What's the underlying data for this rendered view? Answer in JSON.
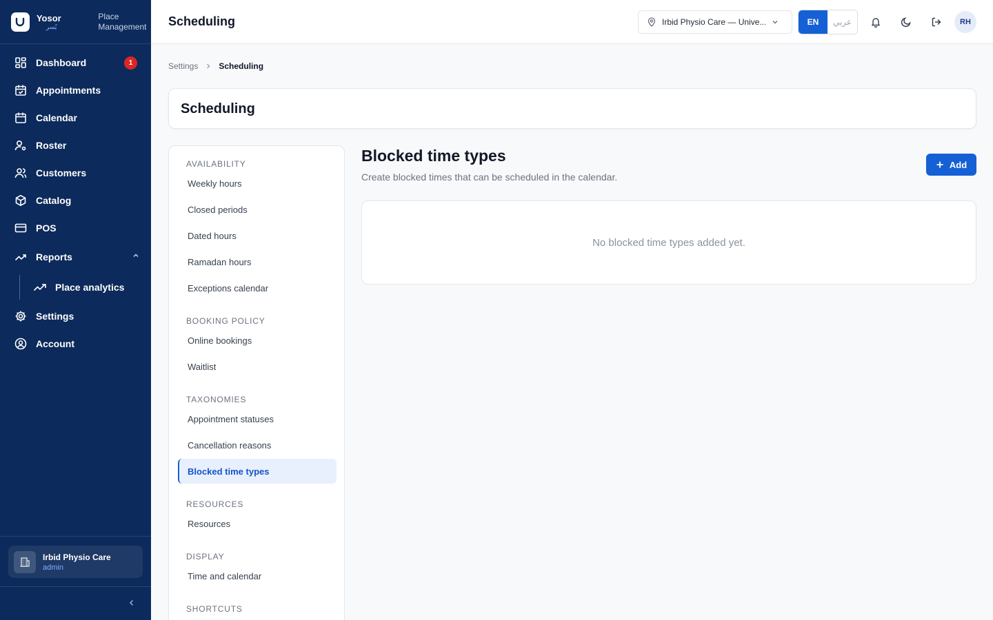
{
  "brand": {
    "name": "Yosor",
    "name_ar": "يُسر",
    "subtitle": "Place Management"
  },
  "sidebar": {
    "items": [
      {
        "label": "Dashboard",
        "icon": "dashboard-icon",
        "badge": "1"
      },
      {
        "label": "Appointments",
        "icon": "calendar-check-icon"
      },
      {
        "label": "Calendar",
        "icon": "calendar-icon"
      },
      {
        "label": "Roster",
        "icon": "user-gear-icon"
      },
      {
        "label": "Customers",
        "icon": "users-icon"
      },
      {
        "label": "Catalog",
        "icon": "package-icon"
      },
      {
        "label": "POS",
        "icon": "credit-card-icon"
      },
      {
        "label": "Reports",
        "icon": "trending-up-icon",
        "expanded": true
      },
      {
        "label": "Place analytics",
        "icon": "trending-up-icon",
        "sub": true
      },
      {
        "label": "Settings",
        "icon": "gear-icon"
      },
      {
        "label": "Account",
        "icon": "user-circle-icon"
      }
    ],
    "org": {
      "name": "Irbid Physio Care",
      "role": "admin"
    }
  },
  "topbar": {
    "title": "Scheduling",
    "location": "Irbid Physio Care — Unive...",
    "lang_en": "EN",
    "lang_ar": "عربي",
    "avatar": "RH"
  },
  "breadcrumb": {
    "parent": "Settings",
    "current": "Scheduling"
  },
  "page": {
    "title": "Scheduling"
  },
  "subnav": {
    "sections": [
      {
        "heading": "AVAILABILITY",
        "items": [
          "Weekly hours",
          "Closed periods",
          "Dated hours",
          "Ramadan hours",
          "Exceptions calendar"
        ]
      },
      {
        "heading": "BOOKING POLICY",
        "items": [
          "Online bookings",
          "Waitlist"
        ]
      },
      {
        "heading": "TAXONOMIES",
        "items": [
          "Appointment statuses",
          "Cancellation reasons",
          "Blocked time types"
        ]
      },
      {
        "heading": "RESOURCES",
        "items": [
          "Resources"
        ]
      },
      {
        "heading": "DISPLAY",
        "items": [
          "Time and calendar"
        ]
      },
      {
        "heading": "SHORTCUTS",
        "items": []
      }
    ],
    "active": "Blocked time types"
  },
  "content": {
    "title": "Blocked time types",
    "description": "Create blocked times that can be scheduled in the calendar.",
    "add_label": "Add",
    "empty_text": "No blocked time types added yet."
  },
  "colors": {
    "sidebar_bg": "#0c2a5b",
    "accent": "#1560d4",
    "badge": "#dc2626"
  }
}
